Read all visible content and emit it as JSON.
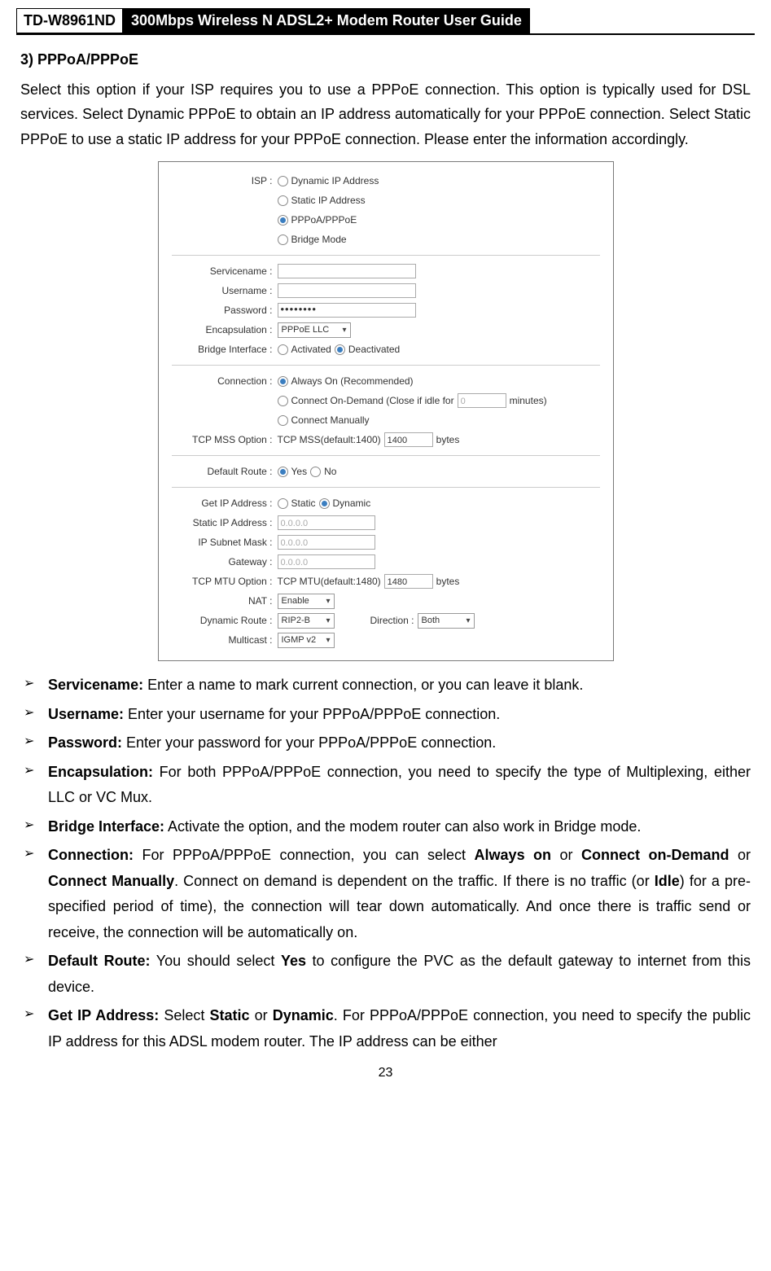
{
  "header": {
    "model": "TD-W8961ND",
    "title": "300Mbps Wireless N ADSL2+ Modem Router User Guide"
  },
  "section": {
    "heading": "3)    PPPoA/PPPoE",
    "intro": "Select this option if your ISP requires you to use a PPPoE connection. This option is typically used for DSL services. Select Dynamic PPPoE to obtain an IP address automatically for your PPPoE connection. Select Static PPPoE to use a static IP address for your PPPoE connection. Please enter the information accordingly."
  },
  "ui": {
    "isp": {
      "label": "ISP :",
      "opt1": "Dynamic IP Address",
      "opt2": "Static IP Address",
      "opt3": "PPPoA/PPPoE",
      "opt4": "Bridge Mode"
    },
    "servicename_label": "Servicename :",
    "servicename_value": "",
    "username_label": "Username :",
    "username_value": "",
    "password_label": "Password :",
    "password_value": "••••••••",
    "encapsulation_label": "Encapsulation :",
    "encapsulation_value": "PPPoE LLC",
    "bridgeif_label": "Bridge Interface :",
    "bridge_act": "Activated",
    "bridge_deact": "Deactivated",
    "connection_label": "Connection :",
    "conn_opt1": "Always On (Recommended)",
    "conn_opt2a": "Connect On-Demand (Close if idle for",
    "conn_opt2_val": "0",
    "conn_opt2b": "minutes)",
    "conn_opt3": "Connect Manually",
    "tcpmss_label": "TCP MSS Option :",
    "tcpmss_text": "TCP MSS(default:1400)",
    "tcpmss_val": "1400",
    "bytes": "bytes",
    "defroute_label": "Default Route :",
    "yes": "Yes",
    "no": "No",
    "getip_label": "Get IP Address :",
    "static": "Static",
    "dynamic": "Dynamic",
    "staticip_label": "Static IP Address :",
    "staticip_val": "0.0.0.0",
    "subnet_label": "IP Subnet Mask :",
    "subnet_val": "0.0.0.0",
    "gateway_label": "Gateway :",
    "gateway_val": "0.0.0.0",
    "tcpmtu_label": "TCP MTU Option :",
    "tcpmtu_text": "TCP MTU(default:1480)",
    "tcpmtu_val": "1480",
    "nat_label": "NAT :",
    "nat_val": "Enable",
    "dynroute_label": "Dynamic Route :",
    "dynroute_val": "RIP2-B",
    "direction_label": "Direction :",
    "direction_val": "Both",
    "multicast_label": "Multicast :",
    "multicast_val": "IGMP v2"
  },
  "bullets": {
    "b1_t": "Servicename:",
    "b1_d": " Enter a name to mark current connection, or you can leave it blank.",
    "b2_t": "Username:",
    "b2_d": " Enter your username for your PPPoA/PPPoE connection.",
    "b3_t": "Password:",
    "b3_d": " Enter your password for your PPPoA/PPPoE connection.",
    "b4_t": "Encapsulation:",
    "b4_d": " For both PPPoA/PPPoE connection, you need to specify the type of Multiplexing, either LLC or VC Mux.",
    "b5_t": "Bridge Interface:",
    "b5_d": " Activate the option, and the modem router can also work in Bridge mode.",
    "b6_t": "Connection:",
    "b6_d1": " For PPPoA/PPPoE connection, you can select ",
    "b6_s1": "Always on",
    "b6_d2": " or ",
    "b6_s2": "Connect on-Demand",
    "b6_d3": " or ",
    "b6_s3": "Connect Manually",
    "b6_d4": ". Connect on demand is dependent on the traffic. If there is no traffic (or ",
    "b6_s4": "Idle",
    "b6_d5": ") for a pre-specified period of time), the connection will tear down automatically. And once there is traffic send or receive, the connection will be automatically on.",
    "b7_t": "Default Route:",
    "b7_d1": " You should select ",
    "b7_s1": "Yes",
    "b7_d2": " to configure the PVC as the default gateway to internet from this device.",
    "b8_t": "Get IP Address:",
    "b8_d1": " Select ",
    "b8_s1": "Static",
    "b8_d2": " or ",
    "b8_s2": "Dynamic",
    "b8_d3": ". For PPPoA/PPPoE connection, you need to specify the public IP address for this ADSL modem router. The IP address can be either"
  },
  "page_number": "23"
}
